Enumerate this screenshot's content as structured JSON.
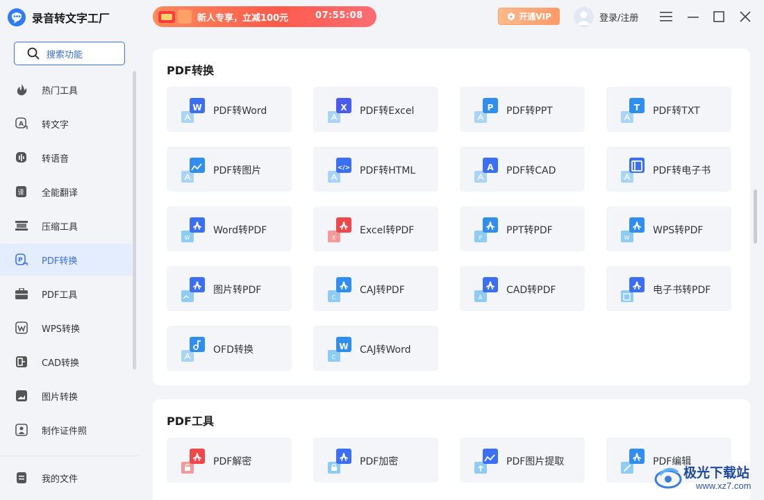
{
  "app": {
    "title": "录音转文字工厂"
  },
  "promo": {
    "text": "新人专享，立减100元",
    "timer": "07:55:08"
  },
  "header": {
    "vip_label": "开通VIP",
    "login_label": "登录/注册"
  },
  "sidebar": {
    "search_label": "搜索功能",
    "items": [
      {
        "label": "热门工具",
        "icon": "flame-icon"
      },
      {
        "label": "转文字",
        "icon": "text-convert-icon"
      },
      {
        "label": "转语音",
        "icon": "voice-icon"
      },
      {
        "label": "全能翻译",
        "icon": "translate-icon"
      },
      {
        "label": "压缩工具",
        "icon": "compress-icon"
      },
      {
        "label": "PDF转换",
        "icon": "pdf-convert-icon",
        "active": true
      },
      {
        "label": "PDF工具",
        "icon": "toolbox-icon"
      },
      {
        "label": "WPS转换",
        "icon": "wps-icon"
      },
      {
        "label": "CAD转换",
        "icon": "cad-icon"
      },
      {
        "label": "图片转换",
        "icon": "image-icon"
      },
      {
        "label": "制作证件照",
        "icon": "id-photo-icon"
      }
    ],
    "bottom_label": "我的文件"
  },
  "sections": [
    {
      "title": "PDF转换",
      "cards": [
        {
          "label": "PDF转Word",
          "glyph": "W",
          "color": "#3b6ff5"
        },
        {
          "label": "PDF转Excel",
          "glyph": "X",
          "color": "#4a5cf0"
        },
        {
          "label": "PDF转PPT",
          "glyph": "P",
          "color": "#2f8ef0"
        },
        {
          "label": "PDF转TXT",
          "glyph": "T",
          "color": "#2f8ef0"
        },
        {
          "label": "PDF转图片",
          "glyph": "img",
          "color": "#2f8ef0"
        },
        {
          "label": "PDF转HTML",
          "glyph": "</>",
          "color": "#3b6ff5"
        },
        {
          "label": "PDF转CAD",
          "glyph": "A",
          "color": "#3b6ff5"
        },
        {
          "label": "PDF转电子书",
          "glyph": "book",
          "color": "#3b6ff5"
        },
        {
          "label": "Word转PDF",
          "glyph": "pdf",
          "color": "#3b6ff5",
          "sub": "W"
        },
        {
          "label": "Excel转PDF",
          "glyph": "pdf",
          "color": "#f0474a",
          "sub": "X"
        },
        {
          "label": "PPT转PDF",
          "glyph": "pdf",
          "color": "#2f8ef0",
          "sub": "P"
        },
        {
          "label": "WPS转PDF",
          "glyph": "pdf",
          "color": "#2f8ef0",
          "sub": "W"
        },
        {
          "label": "图片转PDF",
          "glyph": "pdf",
          "color": "#3b6ff5",
          "sub": "img"
        },
        {
          "label": "CAJ转PDF",
          "glyph": "pdf",
          "color": "#2f8ef0",
          "sub": "C"
        },
        {
          "label": "CAD转PDF",
          "glyph": "pdf",
          "color": "#3b6ff5",
          "sub": "A"
        },
        {
          "label": "电子书转PDF",
          "glyph": "pdf",
          "color": "#3b6ff5",
          "sub": "book"
        },
        {
          "label": "OFD转换",
          "glyph": "ofd",
          "color": "#2f8ef0"
        },
        {
          "label": "CAJ转Word",
          "glyph": "W",
          "color": "#2f8ef0",
          "sub": "C"
        }
      ]
    },
    {
      "title": "PDF工具",
      "cards": [
        {
          "label": "PDF解密",
          "glyph": "pdf",
          "color": "#f0474a",
          "sub": "unlock"
        },
        {
          "label": "PDF加密",
          "glyph": "pdf",
          "color": "#3b6ff5",
          "sub": "lock"
        },
        {
          "label": "PDF图片提取",
          "glyph": "img",
          "color": "#3b6ff5",
          "sub": "up"
        },
        {
          "label": "PDF编辑",
          "glyph": "pdf",
          "color": "#2f8ef0",
          "sub": "edit"
        }
      ]
    }
  ],
  "watermark": {
    "text1": "极光下载站",
    "text2": "www.xz7.com"
  }
}
